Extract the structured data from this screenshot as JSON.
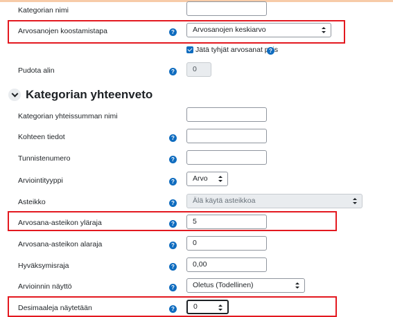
{
  "fields": {
    "category_name_label": "Kategorian nimi",
    "category_name_value": "",
    "aggregation_label": "Arvosanojen koostamistapa",
    "aggregation_value": "Arvosanojen keskiarvo",
    "exclude_empty_label": "Jätä tyhjät arvosanat pois",
    "exclude_empty_checked": true,
    "drop_lowest_label": "Pudota alin",
    "drop_lowest_value": "0"
  },
  "section": {
    "title": "Kategorian yhteenveto",
    "total_name_label": "Kategorian yhteissumman nimi",
    "total_name_value": "",
    "item_info_label": "Kohteen tiedot",
    "item_info_value": "",
    "idnumber_label": "Tunnistenumero",
    "idnumber_value": "",
    "grade_type_label": "Arviointityyppi",
    "grade_type_value": "Arvo",
    "scale_label": "Asteikko",
    "scale_value": "Älä käytä asteikkoa",
    "grade_max_label": "Arvosana-asteikon yläraja",
    "grade_max_value": "5",
    "grade_min_label": "Arvosana-asteikon alaraja",
    "grade_min_value": "0",
    "grade_pass_label": "Hyväksymisraja",
    "grade_pass_value": "0,00",
    "display_type_label": "Arvioinnin näyttö",
    "display_type_value": "Oletus (Todellinen)",
    "decimals_label": "Desimaaleja näytetään",
    "decimals_value": "0"
  },
  "colors": {
    "highlight": "#e3181f",
    "help_icon": "#0f6cbf",
    "checkbox": "#0f6cbf"
  }
}
